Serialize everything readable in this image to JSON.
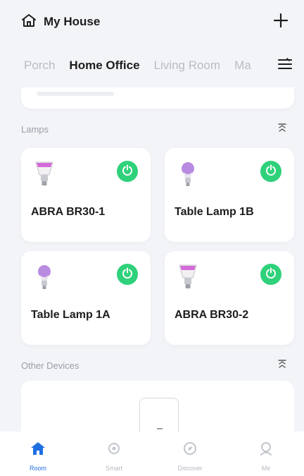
{
  "header": {
    "title": "My House",
    "home_icon": "home-outline-icon",
    "add_icon": "plus-icon"
  },
  "tabs": [
    {
      "label": "Porch",
      "active": false
    },
    {
      "label": "Home Office",
      "active": true
    },
    {
      "label": "Living Room",
      "active": false
    },
    {
      "label": "Ma",
      "active": false
    }
  ],
  "tabs_menu_icon": "list-menu-icon",
  "lamps_section": {
    "label": "Lamps",
    "collapse_icon": "collapse-arrows-icon"
  },
  "devices": [
    {
      "name": "ABRA BR30-1",
      "bulb_icon": "br30-bulb-icon",
      "bulb_color": "#d46ad8",
      "power_on": true
    },
    {
      "name": "Table Lamp 1B",
      "bulb_icon": "a19-bulb-icon",
      "bulb_color": "#b88be0",
      "power_on": true
    },
    {
      "name": "Table Lamp 1A",
      "bulb_icon": "a19-bulb-icon",
      "bulb_color": "#b88be0",
      "power_on": true
    },
    {
      "name": "ABRA BR30-2",
      "bulb_icon": "br30-bulb-icon",
      "bulb_color": "#d46ad8",
      "power_on": true
    }
  ],
  "other_section": {
    "label": "Other Devices",
    "collapse_icon": "collapse-arrows-icon"
  },
  "bottom_nav": [
    {
      "label": "Room",
      "icon": "home-filled-icon",
      "active": true
    },
    {
      "label": "Smart",
      "icon": "smart-icon",
      "active": false
    },
    {
      "label": "Discover",
      "icon": "discover-icon",
      "active": false
    },
    {
      "label": "Me",
      "icon": "profile-icon",
      "active": false
    }
  ],
  "colors": {
    "power_on": "#2fd17a",
    "accent": "#1f6fe0",
    "background": "#f3f4f8"
  }
}
